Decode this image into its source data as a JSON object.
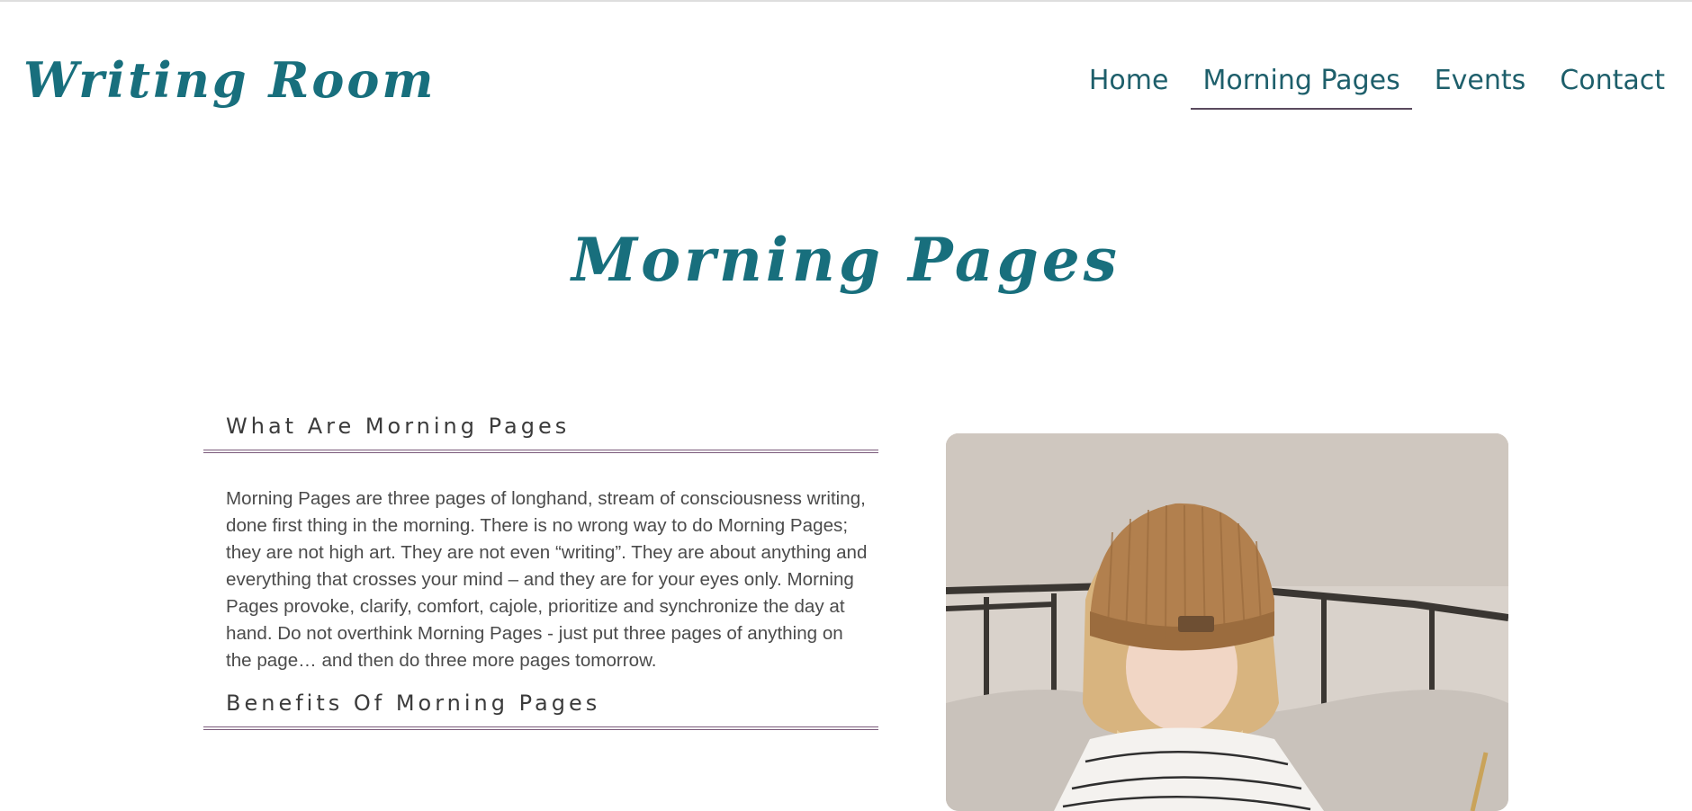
{
  "site": {
    "logo": "Writing Room"
  },
  "nav": {
    "items": [
      {
        "label": "Home"
      },
      {
        "label": "Morning Pages"
      },
      {
        "label": "Events"
      },
      {
        "label": "Contact"
      }
    ],
    "active": "Morning Pages"
  },
  "page": {
    "title": "Morning Pages"
  },
  "sections": [
    {
      "heading": "What Are Morning Pages",
      "text": "Morning Pages are three pages of longhand, stream of consciousness writing, done first thing in the morning. There is no wrong way to do Morning Pages; they are not high art. They are not even “writing”. They are about anything and everything that crosses your mind – and they are for your eyes only. Morning Pages provoke, clarify, comfort, cajole, prioritize and synchronize the day at hand. Do not overthink Morning Pages - just put three pages of anything on the page… and then do three more pages tomorrow."
    },
    {
      "heading": "Benefits Of Morning Pages"
    }
  ],
  "colors": {
    "brand": "#186f7d",
    "nav_text": "#1e5f6b",
    "rule": "#7a5a7a",
    "heading_text": "#3b3b3b",
    "body_text": "#4b4b4b"
  }
}
